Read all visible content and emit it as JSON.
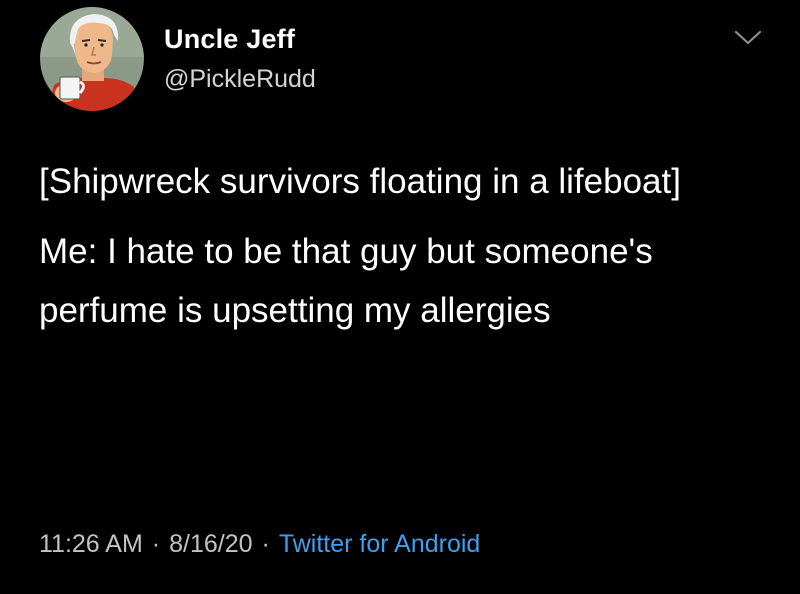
{
  "tweet": {
    "author": {
      "display_name": "Uncle Jeff",
      "handle": "@PickleRudd",
      "avatar_icon": "cartoon-man-with-mug-avatar"
    },
    "menu_icon": "chevron-down-icon",
    "text_paragraphs": [
      "[Shipwreck survivors floating in a lifeboat]",
      "Me: I hate to be that guy but someone's perfume is upsetting my allergies"
    ],
    "meta": {
      "time": "11:26 AM",
      "separator": "·",
      "date": "8/16/20",
      "source": "Twitter for Android"
    }
  },
  "colors": {
    "background": "#000000",
    "text": "#ffffff",
    "secondary_text": "#c3c3c3",
    "link": "#3ba0f0"
  }
}
